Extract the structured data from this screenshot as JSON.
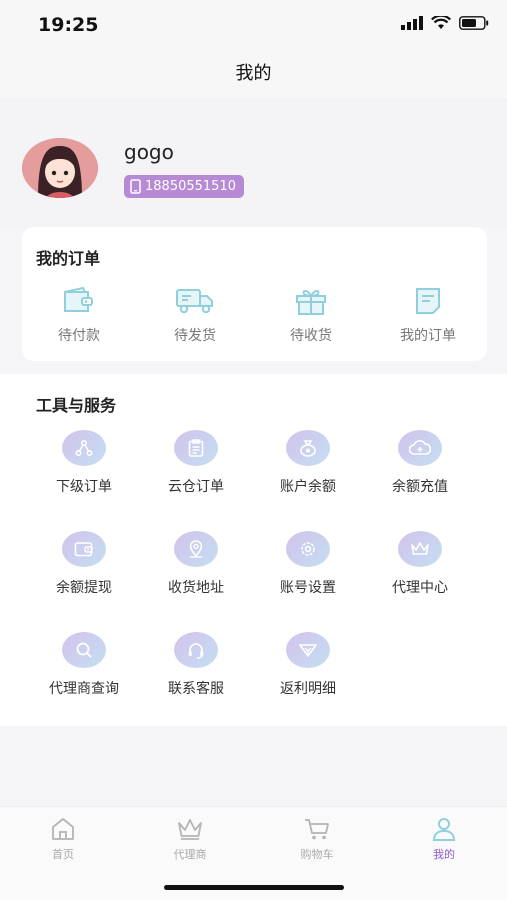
{
  "status": {
    "time": "19:25"
  },
  "nav": {
    "title": "我的"
  },
  "profile": {
    "username": "gogo",
    "phone": "18850551510"
  },
  "orders": {
    "title": "我的订单",
    "items": [
      {
        "label": "待付款",
        "icon": "wallet-icon"
      },
      {
        "label": "待发货",
        "icon": "truck-icon"
      },
      {
        "label": "待收货",
        "icon": "gift-icon"
      },
      {
        "label": "我的订单",
        "icon": "order-list-icon"
      }
    ]
  },
  "tools": {
    "title": "工具与服务",
    "items": [
      {
        "label": "下级订单",
        "icon": "hierarchy-icon"
      },
      {
        "label": "云仓订单",
        "icon": "clipboard-icon"
      },
      {
        "label": "账户余额",
        "icon": "money-bag-icon"
      },
      {
        "label": "余额充值",
        "icon": "cloud-add-icon"
      },
      {
        "label": "余额提现",
        "icon": "wallet-icon"
      },
      {
        "label": "收货地址",
        "icon": "location-icon"
      },
      {
        "label": "账号设置",
        "icon": "gear-icon"
      },
      {
        "label": "代理中心",
        "icon": "crown-icon"
      },
      {
        "label": "代理商查询",
        "icon": "search-icon"
      },
      {
        "label": "联系客服",
        "icon": "headset-icon"
      },
      {
        "label": "返利明细",
        "icon": "rebate-icon"
      }
    ]
  },
  "tabbar": {
    "items": [
      {
        "label": "首页",
        "icon": "home-icon"
      },
      {
        "label": "代理商",
        "icon": "crown-icon"
      },
      {
        "label": "购物车",
        "icon": "cart-icon"
      },
      {
        "label": "我的",
        "icon": "user-icon",
        "active": true
      }
    ]
  },
  "colors": {
    "accent": "#8d5cc7",
    "badge": "#b78ad6",
    "icon_teal": "#8fd0dc"
  }
}
